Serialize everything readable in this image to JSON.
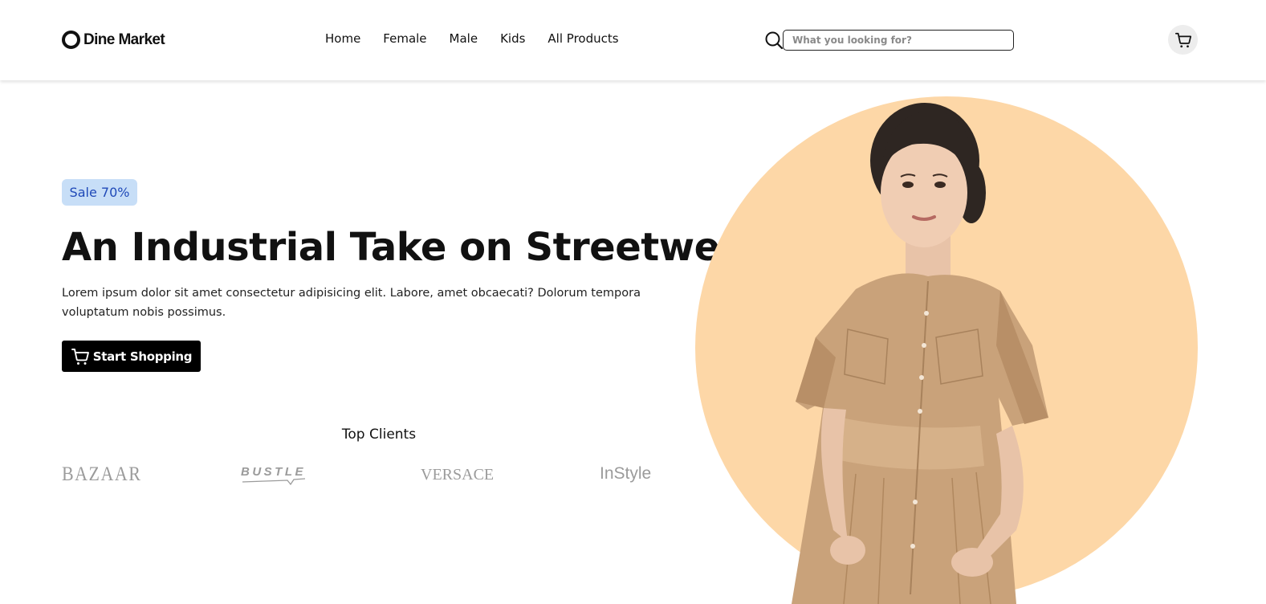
{
  "header": {
    "brand": "Dine Market",
    "nav": [
      "Home",
      "Female",
      "Male",
      "Kids",
      "All Products"
    ],
    "search_placeholder": "What you looking for?",
    "icons": {
      "logo": "ring-logo-icon",
      "search": "search-icon",
      "cart": "cart-icon"
    }
  },
  "hero": {
    "badge": "Sale 70%",
    "title": "An Industrial Take on Streetwear",
    "description": "Lorem ipsum dolor sit amet consectetur adipisicing elit. Labore, amet obcaecati? Dolorum tempora voluptatum nobis possimus.",
    "cta_label": "Start Shopping",
    "cta_icon": "cart-icon"
  },
  "clients": {
    "title": "Top Clients",
    "logos": [
      "BAZAAR",
      "BUSTLE",
      "VERSACE",
      "InStyle"
    ]
  },
  "colors": {
    "badge_bg": "#c7def7",
    "badge_text": "#1f49b8",
    "circle": "#fdd7a7",
    "dress": "#c9a27a",
    "button_bg": "#000000"
  }
}
